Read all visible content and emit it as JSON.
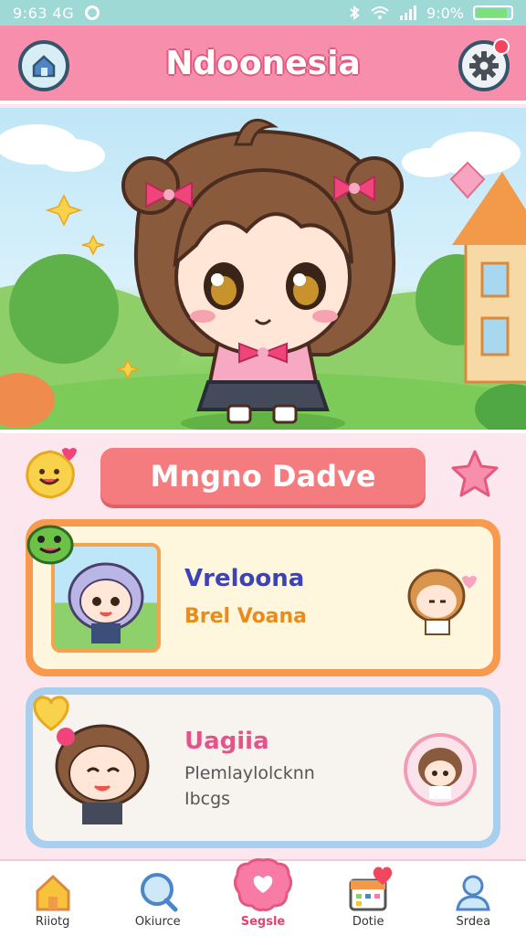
{
  "status_bar": {
    "time": "9:63 4G",
    "battery_text": "9:0%",
    "battery_level": 0.9
  },
  "header": {
    "title": "Ndoonesia",
    "home_icon": "home-icon",
    "settings_icon": "gear-icon"
  },
  "character": {
    "name": "Mngno Dadve"
  },
  "cards": [
    {
      "name": "Vreloona",
      "subtitle": "Brel Voana"
    },
    {
      "name": "Uagiia",
      "subtitle": "Plemlaylolcknn\nIbcgs"
    }
  ],
  "bottom_nav": [
    {
      "label": "Riiotg",
      "icon": "home-icon"
    },
    {
      "label": "Okiurce",
      "icon": "search-icon"
    },
    {
      "label": "Segsle",
      "icon": "heart-icon"
    },
    {
      "label": "Dotie",
      "icon": "calendar-icon"
    },
    {
      "label": "Srdea",
      "icon": "profile-icon"
    }
  ],
  "colors": {
    "header": "#f78fac",
    "accent": "#f57c7e",
    "card_1_border": "#f79a4d",
    "card_2_border": "#a9cfee"
  }
}
